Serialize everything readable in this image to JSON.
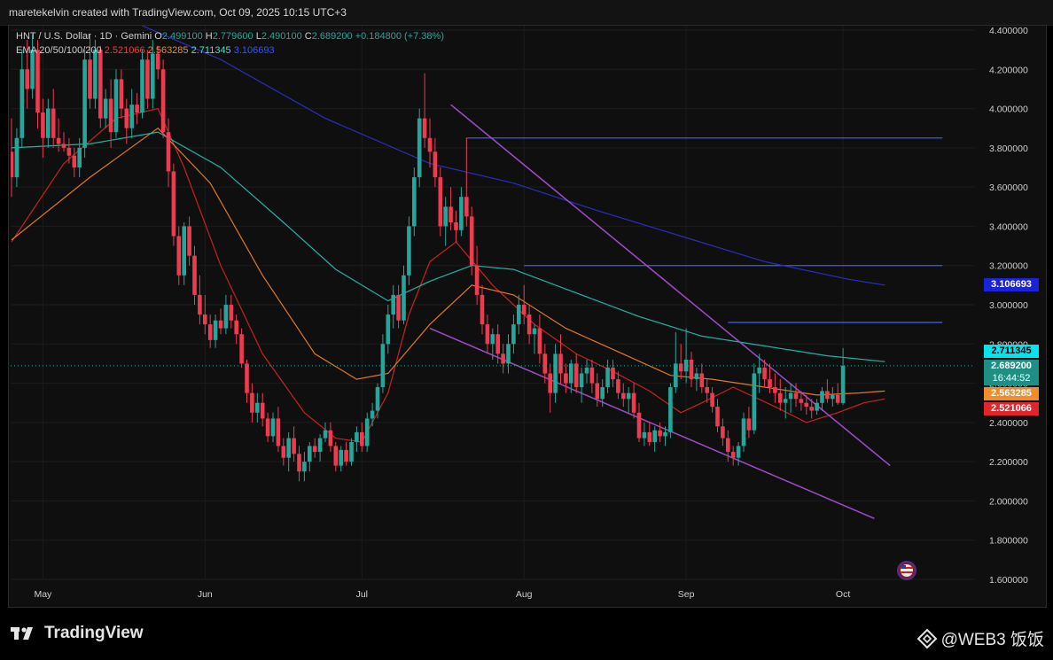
{
  "header": {
    "credit": "maretekelvin created with TradingView.com, Oct 09, 2025 10:15 UTC+3"
  },
  "legend": {
    "symbol": "HNT / U.S. Dollar · 1D · Gemini",
    "o_label": "O",
    "o_value": "2.499100",
    "h_label": "H",
    "h_value": "2.779600",
    "l_label": "L",
    "l_value": "2.490100",
    "c_label": "C",
    "c_value": "2.689200",
    "change": "+0.184800 (+7.38%)",
    "ema_label": "EMA 20/50/100/200",
    "ema20": "2.521066",
    "ema50": "2.563285",
    "ema100": "2.711345",
    "ema200": "3.106693"
  },
  "badges": {
    "ema100": "2.711345",
    "close": "2.689200",
    "countdown": "16:44:52",
    "ema50": "2.563285",
    "ema20": "2.521066",
    "ema200": "3.106693"
  },
  "colors": {
    "up": "#26a69a",
    "down": "#ef3b4f",
    "ema20": "#c8231f",
    "ema50": "#e07a22",
    "ema100": "#1fb5a5",
    "ema200": "#2a2fbf",
    "trendline": "#a04cc8",
    "hline": "#3a5de0",
    "background": "#0f0f0f"
  },
  "footer": {
    "brand": "TradingView",
    "watermark": "@WEB3 饭饭",
    "flag_icon": "us-flag-icon"
  },
  "chart_data": {
    "type": "candlestick",
    "ylim": [
      1.6,
      4.4
    ],
    "y_ticks": [
      "4.400000",
      "4.200000",
      "4.000000",
      "3.800000",
      "3.600000",
      "3.400000",
      "3.200000",
      "3.000000",
      "2.800000",
      "2.600000",
      "2.400000",
      "2.200000",
      "2.000000",
      "1.800000",
      "1.600000"
    ],
    "x_ticks": [
      {
        "label": "May",
        "index": 6
      },
      {
        "label": "Jun",
        "index": 37
      },
      {
        "label": "Jul",
        "index": 67
      },
      {
        "label": "Aug",
        "index": 98
      },
      {
        "label": "Sep",
        "index": 129
      },
      {
        "label": "Oct",
        "index": 159
      }
    ],
    "num_bars": 168,
    "candles": [
      [
        3.78,
        3.95,
        3.55,
        3.65
      ],
      [
        3.65,
        3.9,
        3.6,
        3.85
      ],
      [
        3.85,
        4.3,
        3.8,
        4.2
      ],
      [
        4.2,
        4.35,
        4.0,
        4.1
      ],
      [
        4.1,
        4.38,
        4.05,
        4.3
      ],
      [
        4.3,
        4.35,
        3.9,
        3.98
      ],
      [
        3.98,
        4.05,
        3.75,
        3.85
      ],
      [
        3.85,
        4.05,
        3.8,
        4.0
      ],
      [
        4.0,
        4.1,
        3.8,
        3.85
      ],
      [
        3.85,
        3.95,
        3.78,
        3.82
      ],
      [
        3.82,
        3.88,
        3.78,
        3.8
      ],
      [
        3.8,
        3.85,
        3.72,
        3.76
      ],
      [
        3.76,
        3.8,
        3.65,
        3.7
      ],
      [
        3.7,
        3.85,
        3.65,
        3.8
      ],
      [
        3.8,
        4.3,
        3.75,
        4.25
      ],
      [
        4.25,
        4.38,
        4.0,
        4.05
      ],
      [
        4.05,
        4.35,
        4.0,
        4.3
      ],
      [
        4.3,
        4.32,
        3.9,
        3.95
      ],
      [
        3.95,
        4.1,
        3.9,
        4.05
      ],
      [
        4.05,
        4.15,
        3.8,
        3.88
      ],
      [
        3.88,
        4.2,
        3.85,
        4.15
      ],
      [
        4.15,
        4.2,
        3.95,
        4.0
      ],
      [
        4.0,
        4.05,
        3.82,
        3.9
      ],
      [
        3.9,
        4.1,
        3.85,
        4.02
      ],
      [
        4.02,
        4.08,
        3.92,
        3.98
      ],
      [
        3.98,
        4.3,
        3.95,
        4.25
      ],
      [
        4.25,
        4.3,
        4.0,
        4.05
      ],
      [
        4.05,
        4.35,
        4.0,
        4.28
      ],
      [
        4.28,
        4.32,
        4.15,
        4.2
      ],
      [
        4.2,
        4.25,
        3.85,
        3.88
      ],
      [
        3.88,
        3.95,
        3.6,
        3.68
      ],
      [
        3.68,
        3.72,
        3.3,
        3.35
      ],
      [
        3.35,
        3.4,
        3.1,
        3.15
      ],
      [
        3.15,
        3.42,
        3.1,
        3.4
      ],
      [
        3.4,
        3.45,
        3.2,
        3.25
      ],
      [
        3.25,
        3.3,
        3.0,
        3.05
      ],
      [
        3.05,
        3.15,
        2.9,
        2.95
      ],
      [
        2.95,
        3.05,
        2.85,
        2.9
      ],
      [
        2.9,
        2.95,
        2.78,
        2.82
      ],
      [
        2.82,
        2.95,
        2.78,
        2.92
      ],
      [
        2.92,
        2.98,
        2.85,
        2.88
      ],
      [
        2.88,
        3.05,
        2.85,
        3.0
      ],
      [
        3.0,
        3.05,
        2.88,
        2.92
      ],
      [
        2.92,
        2.95,
        2.8,
        2.85
      ],
      [
        2.85,
        2.88,
        2.68,
        2.7
      ],
      [
        2.7,
        2.72,
        2.5,
        2.55
      ],
      [
        2.55,
        2.6,
        2.4,
        2.45
      ],
      [
        2.45,
        2.55,
        2.4,
        2.5
      ],
      [
        2.5,
        2.55,
        2.38,
        2.42
      ],
      [
        2.42,
        2.45,
        2.3,
        2.33
      ],
      [
        2.33,
        2.45,
        2.3,
        2.42
      ],
      [
        2.42,
        2.48,
        2.25,
        2.28
      ],
      [
        2.28,
        2.32,
        2.18,
        2.22
      ],
      [
        2.22,
        2.35,
        2.15,
        2.32
      ],
      [
        2.32,
        2.38,
        2.2,
        2.24
      ],
      [
        2.24,
        2.28,
        2.1,
        2.15
      ],
      [
        2.15,
        2.25,
        2.1,
        2.2
      ],
      [
        2.2,
        2.3,
        2.15,
        2.28
      ],
      [
        2.28,
        2.32,
        2.22,
        2.25
      ],
      [
        2.25,
        2.34,
        2.2,
        2.32
      ],
      [
        2.32,
        2.4,
        2.3,
        2.36
      ],
      [
        2.36,
        2.4,
        2.25,
        2.28
      ],
      [
        2.28,
        2.3,
        2.15,
        2.18
      ],
      [
        2.18,
        2.28,
        2.15,
        2.26
      ],
      [
        2.26,
        2.3,
        2.18,
        2.2
      ],
      [
        2.2,
        2.32,
        2.18,
        2.3
      ],
      [
        2.3,
        2.38,
        2.25,
        2.35
      ],
      [
        2.35,
        2.4,
        2.25,
        2.28
      ],
      [
        2.28,
        2.45,
        2.25,
        2.42
      ],
      [
        2.42,
        2.5,
        2.38,
        2.46
      ],
      [
        2.46,
        2.6,
        2.42,
        2.58
      ],
      [
        2.58,
        2.85,
        2.55,
        2.8
      ],
      [
        2.8,
        3.0,
        2.75,
        2.95
      ],
      [
        2.95,
        3.1,
        2.88,
        3.05
      ],
      [
        3.05,
        3.1,
        2.88,
        2.92
      ],
      [
        2.92,
        3.2,
        2.9,
        3.15
      ],
      [
        3.15,
        3.45,
        3.1,
        3.4
      ],
      [
        3.4,
        3.7,
        3.35,
        3.65
      ],
      [
        3.65,
        4.0,
        3.6,
        3.95
      ],
      [
        3.95,
        4.18,
        3.8,
        3.85
      ],
      [
        3.85,
        3.95,
        3.7,
        3.78
      ],
      [
        3.78,
        3.85,
        3.6,
        3.65
      ],
      [
        3.65,
        3.7,
        3.35,
        3.4
      ],
      [
        3.4,
        3.55,
        3.3,
        3.5
      ],
      [
        3.5,
        3.6,
        3.38,
        3.42
      ],
      [
        3.42,
        3.48,
        3.32,
        3.38
      ],
      [
        3.38,
        3.6,
        3.35,
        3.55
      ],
      [
        3.55,
        3.85,
        3.4,
        3.45
      ],
      [
        3.45,
        3.5,
        3.15,
        3.2
      ],
      [
        3.2,
        3.3,
        3.0,
        3.05
      ],
      [
        3.05,
        3.1,
        2.85,
        2.9
      ],
      [
        2.9,
        2.95,
        2.75,
        2.8
      ],
      [
        2.8,
        2.88,
        2.72,
        2.85
      ],
      [
        2.85,
        2.9,
        2.7,
        2.75
      ],
      [
        2.75,
        2.8,
        2.65,
        2.7
      ],
      [
        2.7,
        2.85,
        2.65,
        2.8
      ],
      [
        2.8,
        2.95,
        2.75,
        2.9
      ],
      [
        2.9,
        3.05,
        2.85,
        3.0
      ],
      [
        3.0,
        3.1,
        2.9,
        2.95
      ],
      [
        2.95,
        3.0,
        2.8,
        2.85
      ],
      [
        2.85,
        2.9,
        2.75,
        2.88
      ],
      [
        2.88,
        2.95,
        2.7,
        2.75
      ],
      [
        2.75,
        2.8,
        2.6,
        2.65
      ],
      [
        2.65,
        2.7,
        2.45,
        2.55
      ],
      [
        2.55,
        2.8,
        2.5,
        2.75
      ],
      [
        2.75,
        2.85,
        2.6,
        2.65
      ],
      [
        2.65,
        2.7,
        2.55,
        2.6
      ],
      [
        2.6,
        2.72,
        2.55,
        2.7
      ],
      [
        2.7,
        2.75,
        2.55,
        2.58
      ],
      [
        2.58,
        2.68,
        2.5,
        2.65
      ],
      [
        2.65,
        2.72,
        2.6,
        2.68
      ],
      [
        2.68,
        2.72,
        2.55,
        2.6
      ],
      [
        2.6,
        2.65,
        2.48,
        2.52
      ],
      [
        2.52,
        2.62,
        2.48,
        2.58
      ],
      [
        2.58,
        2.72,
        2.55,
        2.68
      ],
      [
        2.68,
        2.72,
        2.58,
        2.62
      ],
      [
        2.62,
        2.66,
        2.52,
        2.55
      ],
      [
        2.55,
        2.6,
        2.48,
        2.52
      ],
      [
        2.52,
        2.58,
        2.45,
        2.55
      ],
      [
        2.55,
        2.6,
        2.42,
        2.45
      ],
      [
        2.45,
        2.5,
        2.3,
        2.32
      ],
      [
        2.32,
        2.4,
        2.28,
        2.35
      ],
      [
        2.35,
        2.4,
        2.28,
        2.3
      ],
      [
        2.3,
        2.38,
        2.25,
        2.36
      ],
      [
        2.36,
        2.4,
        2.3,
        2.33
      ],
      [
        2.33,
        2.38,
        2.28,
        2.35
      ],
      [
        2.35,
        2.6,
        2.32,
        2.58
      ],
      [
        2.58,
        2.86,
        2.55,
        2.7
      ],
      [
        2.7,
        2.8,
        2.62,
        2.66
      ],
      [
        2.66,
        2.88,
        2.6,
        2.72
      ],
      [
        2.72,
        2.76,
        2.58,
        2.62
      ],
      [
        2.62,
        2.68,
        2.56,
        2.65
      ],
      [
        2.65,
        2.7,
        2.55,
        2.58
      ],
      [
        2.58,
        2.62,
        2.5,
        2.55
      ],
      [
        2.55,
        2.58,
        2.45,
        2.48
      ],
      [
        2.48,
        2.52,
        2.35,
        2.38
      ],
      [
        2.38,
        2.42,
        2.28,
        2.32
      ],
      [
        2.32,
        2.36,
        2.2,
        2.25
      ],
      [
        2.25,
        2.28,
        2.18,
        2.22
      ],
      [
        2.22,
        2.3,
        2.18,
        2.28
      ],
      [
        2.28,
        2.45,
        2.25,
        2.42
      ],
      [
        2.42,
        2.48,
        2.32,
        2.36
      ],
      [
        2.36,
        2.7,
        2.34,
        2.65
      ],
      [
        2.65,
        2.75,
        2.55,
        2.68
      ],
      [
        2.68,
        2.72,
        2.58,
        2.62
      ],
      [
        2.62,
        2.7,
        2.55,
        2.58
      ],
      [
        2.58,
        2.65,
        2.5,
        2.55
      ],
      [
        2.55,
        2.62,
        2.46,
        2.5
      ],
      [
        2.5,
        2.58,
        2.42,
        2.52
      ],
      [
        2.52,
        2.6,
        2.45,
        2.55
      ],
      [
        2.55,
        2.6,
        2.48,
        2.52
      ],
      [
        2.52,
        2.56,
        2.46,
        2.5
      ],
      [
        2.5,
        2.54,
        2.44,
        2.48
      ],
      [
        2.48,
        2.52,
        2.42,
        2.46
      ],
      [
        2.46,
        2.52,
        2.44,
        2.5
      ],
      [
        2.5,
        2.58,
        2.46,
        2.56
      ],
      [
        2.56,
        2.62,
        2.5,
        2.52
      ],
      [
        2.52,
        2.58,
        2.48,
        2.54
      ],
      [
        2.54,
        2.6,
        2.49,
        2.5
      ],
      [
        2.4991,
        2.7796,
        2.4901,
        2.6892
      ]
    ],
    "ema": [
      {
        "name": "EMA 20",
        "value": 2.521066,
        "points": [
          [
            0,
            3.32
          ],
          [
            10,
            3.72
          ],
          [
            20,
            3.95
          ],
          [
            28,
            4.0
          ],
          [
            33,
            3.7
          ],
          [
            40,
            3.2
          ],
          [
            48,
            2.75
          ],
          [
            56,
            2.45
          ],
          [
            62,
            2.32
          ],
          [
            67,
            2.3
          ],
          [
            72,
            2.55
          ],
          [
            76,
            2.95
          ],
          [
            80,
            3.22
          ],
          [
            85,
            3.32
          ],
          [
            92,
            3.1
          ],
          [
            100,
            2.9
          ],
          [
            108,
            2.75
          ],
          [
            115,
            2.66
          ],
          [
            122,
            2.56
          ],
          [
            128,
            2.45
          ],
          [
            132,
            2.5
          ],
          [
            138,
            2.58
          ],
          [
            146,
            2.48
          ],
          [
            152,
            2.4
          ],
          [
            158,
            2.45
          ],
          [
            163,
            2.5
          ],
          [
            167,
            2.52
          ]
        ]
      },
      {
        "name": "EMA 50",
        "value": 2.563285,
        "points": [
          [
            0,
            3.33
          ],
          [
            15,
            3.65
          ],
          [
            28,
            3.9
          ],
          [
            38,
            3.62
          ],
          [
            48,
            3.15
          ],
          [
            58,
            2.75
          ],
          [
            66,
            2.62
          ],
          [
            72,
            2.65
          ],
          [
            80,
            2.9
          ],
          [
            88,
            3.1
          ],
          [
            96,
            3.05
          ],
          [
            106,
            2.88
          ],
          [
            116,
            2.76
          ],
          [
            126,
            2.64
          ],
          [
            134,
            2.62
          ],
          [
            144,
            2.58
          ],
          [
            154,
            2.54
          ],
          [
            162,
            2.55
          ],
          [
            167,
            2.56
          ]
        ]
      },
      {
        "name": "EMA 100",
        "value": 2.711345,
        "points": [
          [
            0,
            3.8
          ],
          [
            15,
            3.82
          ],
          [
            28,
            3.88
          ],
          [
            40,
            3.7
          ],
          [
            52,
            3.42
          ],
          [
            62,
            3.18
          ],
          [
            72,
            3.02
          ],
          [
            80,
            3.12
          ],
          [
            88,
            3.2
          ],
          [
            96,
            3.18
          ],
          [
            108,
            3.06
          ],
          [
            120,
            2.94
          ],
          [
            132,
            2.84
          ],
          [
            144,
            2.79
          ],
          [
            156,
            2.74
          ],
          [
            167,
            2.71
          ]
        ]
      },
      {
        "name": "EMA 200",
        "value": 3.106693,
        "points": [
          [
            0,
            4.55
          ],
          [
            20,
            4.48
          ],
          [
            40,
            4.25
          ],
          [
            60,
            3.95
          ],
          [
            80,
            3.72
          ],
          [
            96,
            3.62
          ],
          [
            112,
            3.48
          ],
          [
            128,
            3.35
          ],
          [
            144,
            3.22
          ],
          [
            160,
            3.13
          ],
          [
            167,
            3.1
          ]
        ]
      }
    ],
    "trendlines": [
      {
        "from": [
          84,
          4.02
        ],
        "to": [
          168,
          2.18
        ]
      },
      {
        "from": [
          80,
          2.88
        ],
        "to": [
          165,
          1.91
        ]
      }
    ],
    "hlines": [
      {
        "value": 3.85,
        "from": 87,
        "to": 178
      },
      {
        "value": 3.2,
        "from": 98,
        "to": 178
      },
      {
        "value": 2.91,
        "from": 137,
        "to": 178
      }
    ],
    "current_price_line": 2.6892
  }
}
